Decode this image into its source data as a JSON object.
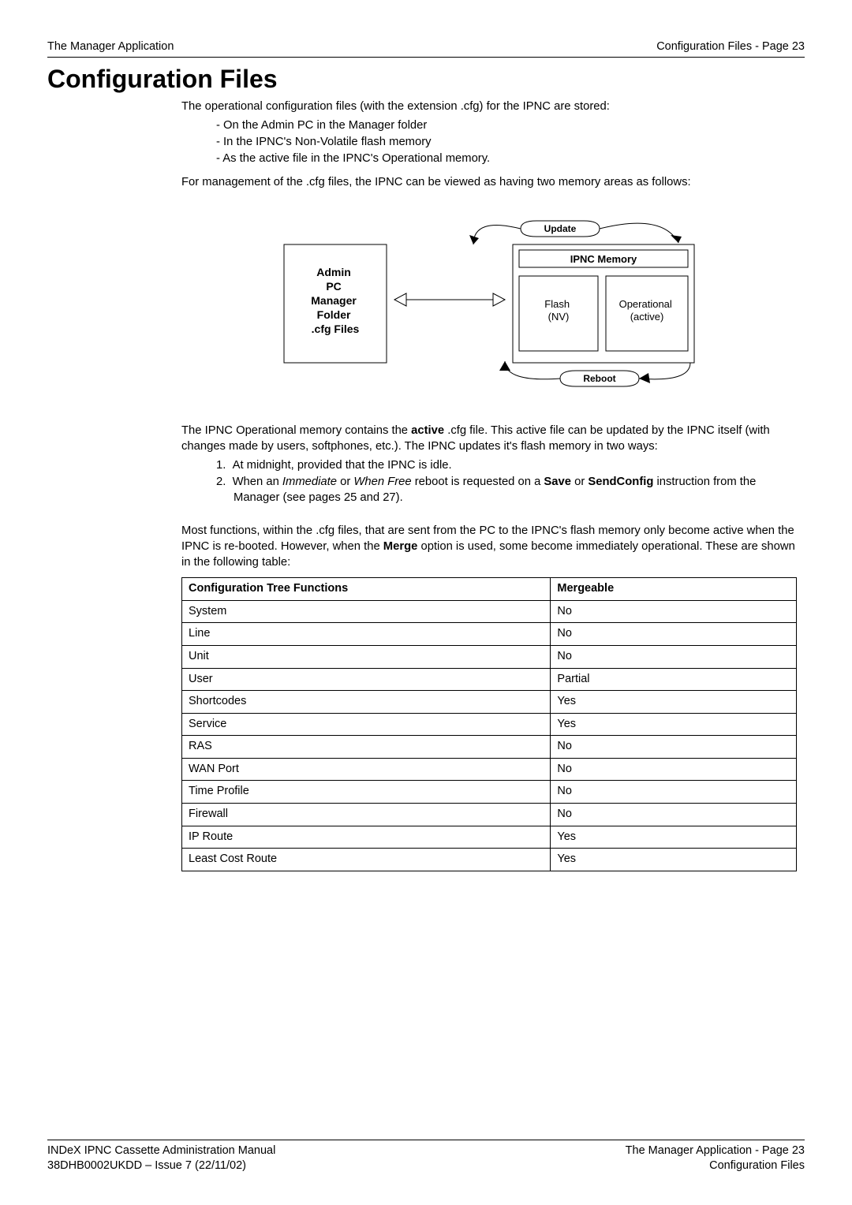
{
  "header": {
    "left": "The Manager Application",
    "right": "Configuration Files - Page 23"
  },
  "title": "Configuration Files",
  "intro": "The operational configuration files (with the extension .cfg) for the IPNC are stored:",
  "stored_list": [
    "On the Admin PC in the Manager folder",
    "In the IPNC's Non-Volatile flash memory",
    "As the active file in the IPNC's Operational memory."
  ],
  "mgmt_para": "For management of the .cfg files, the IPNC can be viewed as having two memory areas as follows:",
  "diagram": {
    "admin_box": "Admin\nPC\nManager\nFolder\n.cfg Files",
    "update": "Update",
    "ipnc_memory": "IPNC Memory",
    "flash": "Flash\n(NV)",
    "operational": "Operational\n(active)",
    "reboot": "Reboot"
  },
  "post_diagram_para": "The IPNC Operational memory contains the ",
  "post_diagram_bold": "active",
  "post_diagram_tail": " .cfg file. This active file can be updated by the IPNC itself (with changes made by users, softphones, etc.). The IPNC updates it's flash memory in two ways:",
  "num_list": [
    {
      "n": "1.",
      "pre": "At midnight, provided that the IPNC is idle."
    },
    {
      "n": "2.",
      "pre": "When an ",
      "i1": "Immediate",
      "mid": " or ",
      "i2": "When Free",
      "post": " reboot is requested on a ",
      "b1": "Save",
      "post2": " or ",
      "b2": "SendConfig",
      "tail": " instruction from the Manager (see pages 25 and 27)."
    }
  ],
  "merge_para_pre": "Most functions, within the .cfg files, that are sent from the PC to the IPNC's flash memory only become active when the IPNC is re-booted. However, when the ",
  "merge_bold": "Merge",
  "merge_para_post": " option is used, some become immediately operational. These are shown in the following table:",
  "table": {
    "headers": [
      "Configuration Tree Functions",
      "Mergeable"
    ],
    "rows": [
      [
        "System",
        "No"
      ],
      [
        "Line",
        "No"
      ],
      [
        "Unit",
        "No"
      ],
      [
        "User",
        "Partial"
      ],
      [
        "Shortcodes",
        "Yes"
      ],
      [
        "Service",
        "Yes"
      ],
      [
        "RAS",
        "No"
      ],
      [
        "WAN Port",
        "No"
      ],
      [
        "Time Profile",
        "No"
      ],
      [
        "Firewall",
        "No"
      ],
      [
        "IP Route",
        "Yes"
      ],
      [
        "Least Cost Route",
        "Yes"
      ]
    ]
  },
  "footer": {
    "left1": "INDeX IPNC Cassette Administration Manual",
    "left2": "38DHB0002UKDD – Issue 7 (22/11/02)",
    "right1": "The Manager Application - Page 23",
    "right2": "Configuration Files"
  }
}
